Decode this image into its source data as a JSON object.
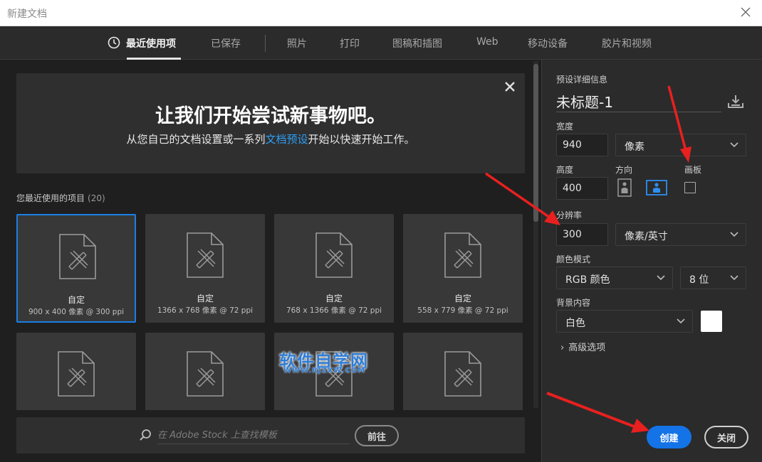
{
  "window": {
    "title": "新建文档"
  },
  "tabs": [
    {
      "label": "最近使用项",
      "active": true
    },
    {
      "label": "已保存"
    },
    {
      "label": "照片"
    },
    {
      "label": "打印"
    },
    {
      "label": "图稿和插图"
    },
    {
      "label": "Web"
    },
    {
      "label": "移动设备"
    },
    {
      "label": "胶片和视频"
    }
  ],
  "welcome": {
    "headline": "让我们开始尝试新事物吧。",
    "sub_before": "从您自己的文档设置或一系列",
    "sub_link": "文档预设",
    "sub_after": "开始以快速开始工作。"
  },
  "recent": {
    "label": "您最近使用的项目",
    "count": "(20)",
    "items": [
      {
        "name": "自定",
        "meta": "900 x 400 像素 @ 300 ppi",
        "selected": true
      },
      {
        "name": "自定",
        "meta": "1366 x 768 像素 @ 72 ppi"
      },
      {
        "name": "自定",
        "meta": "768 x 1366 像素 @ 72 ppi"
      },
      {
        "name": "自定",
        "meta": "558 x 779 像素 @ 72 ppi"
      },
      {
        "name": "",
        "meta": ""
      },
      {
        "name": "",
        "meta": ""
      },
      {
        "name": "",
        "meta": ""
      },
      {
        "name": "",
        "meta": ""
      }
    ]
  },
  "stock": {
    "placeholder": "在 Adobe Stock 上查找模板",
    "go_label": "前往"
  },
  "preset": {
    "section_label": "预设详细信息",
    "doc_name": "未标题-1",
    "width_label": "宽度",
    "width_value": "940",
    "width_unit": "像素",
    "height_label": "高度",
    "height_value": "400",
    "orientation_label": "方向",
    "artboard_label": "画板",
    "resolution_label": "分辨率",
    "resolution_value": "300",
    "resolution_unit": "像素/英寸",
    "color_mode_label": "颜色模式",
    "color_mode": "RGB 颜色",
    "bit_depth": "8 位",
    "background_label": "背景内容",
    "background": "白色",
    "background_color": "#ffffff",
    "advanced_label": "高级选项"
  },
  "actions": {
    "create": "创建",
    "close": "关闭"
  },
  "watermark": {
    "big": "软件自学网",
    "small": "WWW.RJZXW.COM"
  },
  "colors": {
    "accent": "#1473e6",
    "link": "#2d9ef5",
    "arrow": "#e8201f"
  }
}
